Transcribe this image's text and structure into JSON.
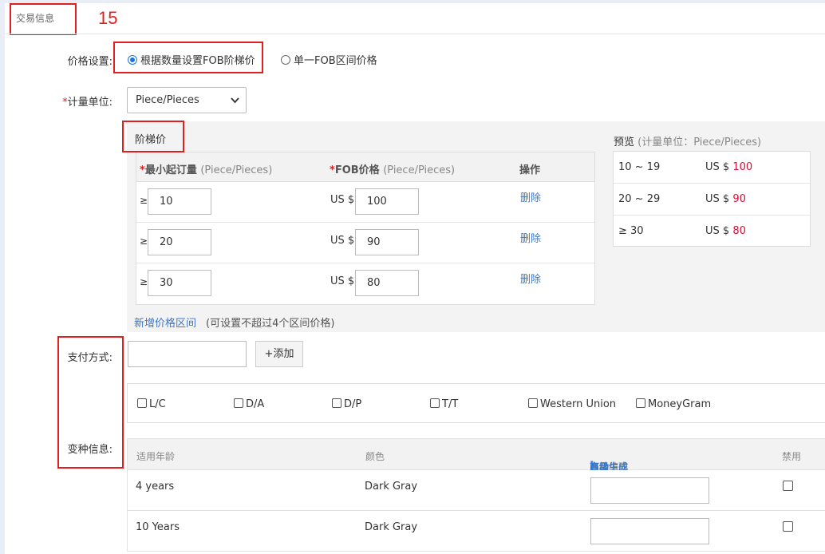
{
  "section": {
    "title": "交易信息",
    "annotation_number": "15"
  },
  "price_setting": {
    "label": "价格设置:",
    "options": [
      {
        "label": "根据数量设置FOB阶梯价",
        "selected": true
      },
      {
        "label": "单一FOB区间价格",
        "selected": false
      }
    ]
  },
  "unit": {
    "required_mark": "*",
    "label": "计量单位:",
    "value": "Piece/Pieces"
  },
  "tier_pricing": {
    "title": "阶梯价",
    "headers": {
      "min_order_mark": "*",
      "min_order": "最小起订量",
      "min_order_unit": "(Piece/Pieces)",
      "fob_mark": "*",
      "fob": "FOB价格",
      "fob_unit": "(Piece/Pieces)",
      "action": "操作"
    },
    "rows": [
      {
        "ge": "≥",
        "min_qty": "10",
        "currency": "US $",
        "price": "100",
        "delete": "删除"
      },
      {
        "ge": "≥",
        "min_qty": "20",
        "currency": "US $",
        "price": "90",
        "delete": "删除"
      },
      {
        "ge": "≥",
        "min_qty": "30",
        "currency": "US $",
        "price": "80",
        "delete": "删除"
      }
    ],
    "add_link": "新增价格区间",
    "add_note": "(可设置不超过4个区间价格)"
  },
  "preview": {
    "title": "预览",
    "unit_note": "(计量单位：Piece/Pieces)",
    "rows": [
      {
        "range": "10 ~ 19",
        "currency": "US $",
        "price": "100"
      },
      {
        "range": "20 ~ 29",
        "currency": "US $",
        "price": "90"
      },
      {
        "range": "≥ 30",
        "currency": "US $",
        "price": "80"
      }
    ]
  },
  "payment": {
    "label": "支付方式:",
    "add_button": "+添加",
    "options": [
      "L/C",
      "D/A",
      "D/P",
      "T/T",
      "Western Union",
      "MoneyGram"
    ]
  },
  "variants": {
    "label": "变种信息:",
    "headers": {
      "age": "适用年龄",
      "color": "颜色",
      "code": "商品编码",
      "code_paren_open": "(",
      "auto": "自动生成",
      "dot": "•",
      "advanced": "高级",
      "code_paren_close": ")",
      "disable": "禁用"
    },
    "rows": [
      {
        "age": "4 years",
        "color": "Dark Gray"
      },
      {
        "age": "10 Years",
        "color": "Dark Gray"
      }
    ]
  },
  "colors": {
    "annotation_red": "#e02020",
    "link_blue": "#3a78c9",
    "price_red": "#d0103a"
  }
}
